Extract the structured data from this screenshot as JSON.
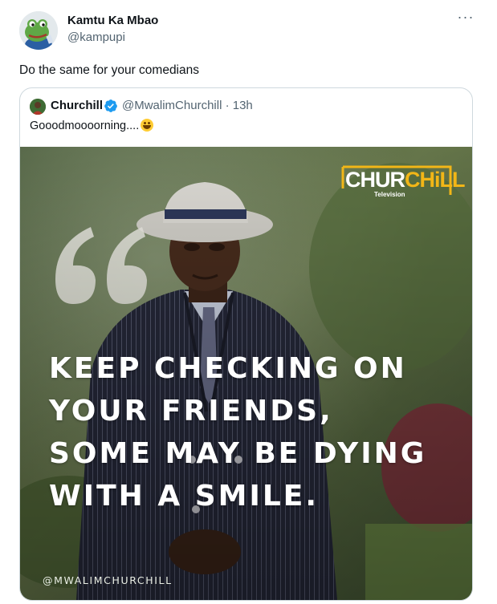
{
  "tweet": {
    "author_name": "Kamtu Ka Mbao",
    "author_handle": "@kampupi",
    "more_label": "···",
    "text": "Do the same for your comedians"
  },
  "quoted_tweet": {
    "author_name": "Churchill",
    "author_handle_time": "@MwalimChurchill · 13h",
    "text": "Gooodmoooorning....",
    "verified_color": "#1d9bf0",
    "media": {
      "logo_main_a": "CHUR",
      "logo_main_b": "CHiLL",
      "logo_sub": "Television",
      "quote_lines": [
        "KEEP CHECKING ON",
        "YOUR FRIENDS,",
        "SOME MAY BE DYING",
        "WITH A SMILE."
      ],
      "watermark": "@MWALIMCHURCHILL"
    }
  },
  "colors": {
    "accent_logo": "#f2b617",
    "text_secondary": "#536471",
    "border": "#cfd9de"
  }
}
